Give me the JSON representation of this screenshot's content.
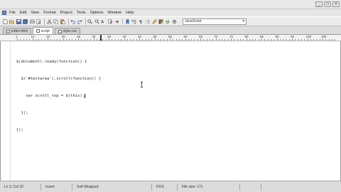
{
  "window": {
    "controls": [
      "_",
      "□",
      "×"
    ]
  },
  "menubar": {
    "items": [
      "File",
      "Edit",
      "View",
      "Format",
      "Project",
      "Tools",
      "Options",
      "Window",
      "Help"
    ]
  },
  "toolbar": {
    "syntax_value": "JavaScript"
  },
  "tabs": [
    {
      "label": "index.html",
      "active": false
    },
    {
      "label": "script",
      "active": true
    },
    {
      "label": "style.css",
      "active": false
    }
  ],
  "ruler": {
    "labels": [
      "1",
      "10",
      "15",
      "20",
      "25",
      "30",
      "35",
      "40",
      "45",
      "50",
      "55",
      "60",
      "65",
      "70",
      "75",
      "80",
      "85",
      "90",
      "95",
      "100",
      "105"
    ]
  },
  "editor": {
    "lines": [
      "$(document).ready(function() {",
      "  $('#textarea').scroll(function() {",
      "    var scroll_top = $(this).",
      "  });",
      "});"
    ]
  },
  "statusbar": {
    "position": "Ln 3, Col 33",
    "mode": "Insert",
    "view": "Soft Wrapped",
    "encoding": "DOS",
    "file_size": "File size: 171"
  }
}
